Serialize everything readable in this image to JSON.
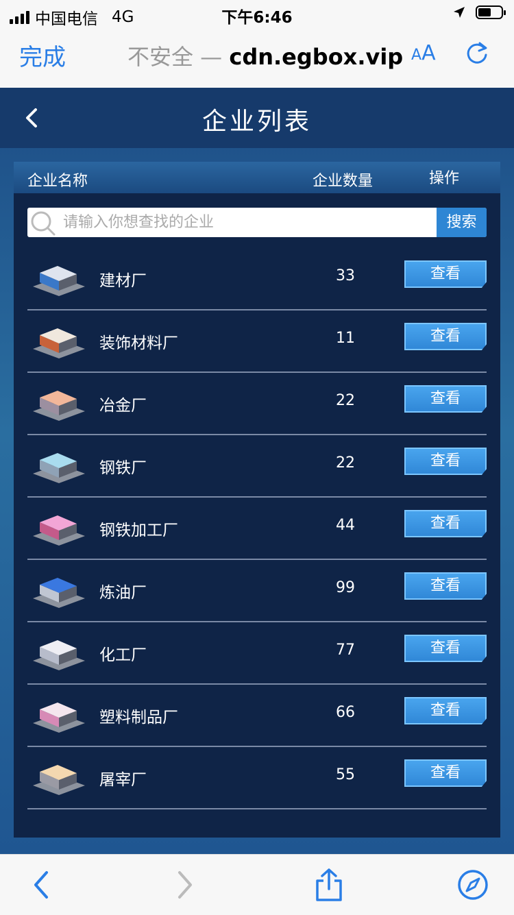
{
  "status_bar": {
    "carrier": "中国电信",
    "network": "4G",
    "time": "下午6:46"
  },
  "browser": {
    "done_label": "完成",
    "url_prefix": "不安全 — ",
    "url_domain": "cdn.egbox.vip",
    "text_size_label_small": "A",
    "text_size_label_large": "A"
  },
  "app": {
    "title": "企业列表",
    "columns": {
      "name": "企业名称",
      "count": "企业数量",
      "action": "操作"
    },
    "search": {
      "placeholder": "请输入你想查找的企业",
      "button_label": "搜索"
    },
    "view_label": "查看",
    "rows": [
      {
        "name": "建材厂",
        "count": "33",
        "icon": "building-materials-factory-icon",
        "roof_color": "#dfe4ee",
        "wall_color": "#3a78c8"
      },
      {
        "name": "装饰材料厂",
        "count": "11",
        "icon": "decoration-materials-factory-icon",
        "roof_color": "#f0e8de",
        "wall_color": "#c8623a"
      },
      {
        "name": "冶金厂",
        "count": "22",
        "icon": "metallurgy-factory-icon",
        "roof_color": "#f2b79a",
        "wall_color": "#9c8fa0"
      },
      {
        "name": "钢铁厂",
        "count": "22",
        "icon": "steel-factory-icon",
        "roof_color": "#a9dcef",
        "wall_color": "#8fa2b6"
      },
      {
        "name": "钢铁加工厂",
        "count": "44",
        "icon": "steel-processing-factory-icon",
        "roof_color": "#f2a6d6",
        "wall_color": "#c45a8a"
      },
      {
        "name": "炼油厂",
        "count": "99",
        "icon": "oil-refinery-icon",
        "roof_color": "#3a78e0",
        "wall_color": "#c0c6d2"
      },
      {
        "name": "化工厂",
        "count": "77",
        "icon": "chemical-plant-icon",
        "roof_color": "#eeeef4",
        "wall_color": "#b7bccb"
      },
      {
        "name": "塑料制品厂",
        "count": "66",
        "icon": "plastic-products-factory-icon",
        "roof_color": "#f4e6ee",
        "wall_color": "#d78ab6"
      },
      {
        "name": "屠宰厂",
        "count": "55",
        "icon": "slaughterhouse-icon",
        "roof_color": "#f4d8b0",
        "wall_color": "#9a9aa4"
      }
    ]
  }
}
